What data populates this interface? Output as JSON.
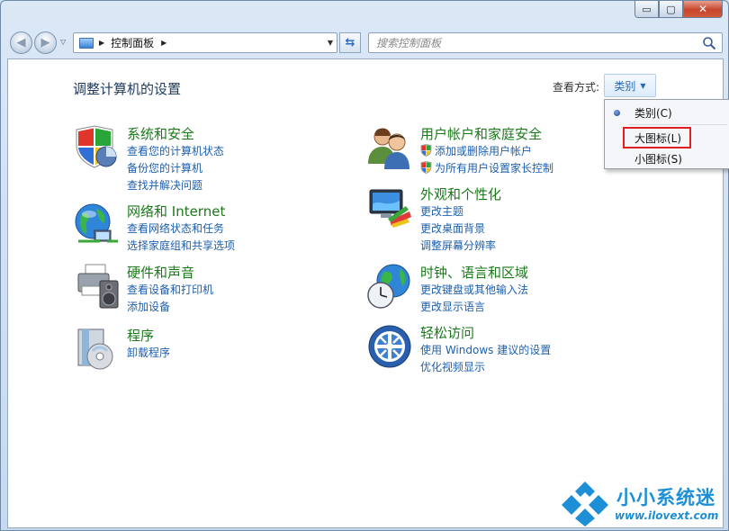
{
  "window": {
    "caption": {
      "minimize": "▭",
      "maximize": "▢",
      "close": "✕"
    }
  },
  "navbar": {
    "address": "控制面板",
    "search_placeholder": "搜索控制面板"
  },
  "page": {
    "title": "调整计算机的设置",
    "view_by_label": "查看方式:",
    "view_by_value": "类别"
  },
  "view_menu": {
    "items": [
      {
        "label": "类别(C)",
        "selected": true
      },
      {
        "label": "大图标(L)",
        "highlighted": true
      },
      {
        "label": "小图标(S)"
      }
    ]
  },
  "categories": [
    {
      "title": "系统和安全",
      "icon": "system-security-icon",
      "links": [
        "查看您的计算机状态",
        "备份您的计算机",
        "查找并解决问题"
      ]
    },
    {
      "title": "网络和 Internet",
      "icon": "network-internet-icon",
      "links": [
        "查看网络状态和任务",
        "选择家庭组和共享选项"
      ]
    },
    {
      "title": "硬件和声音",
      "icon": "hardware-sound-icon",
      "links": [
        "查看设备和打印机",
        "添加设备"
      ]
    },
    {
      "title": "程序",
      "icon": "programs-icon",
      "links": [
        "卸载程序"
      ]
    },
    {
      "title": "用户帐户和家庭安全",
      "icon": "user-accounts-icon",
      "links": [
        "添加或删除用户帐户",
        "为所有用户设置家长控制"
      ]
    },
    {
      "title": "外观和个性化",
      "icon": "appearance-icon",
      "links": [
        "更改主题",
        "更改桌面背景",
        "调整屏幕分辨率"
      ]
    },
    {
      "title": "时钟、语言和区域",
      "icon": "clock-language-icon",
      "links": [
        "更改键盘或其他输入法",
        "更改显示语言"
      ]
    },
    {
      "title": "轻松访问",
      "icon": "ease-of-access-icon",
      "links": [
        "使用 Windows 建议的设置",
        "优化视频显示"
      ]
    }
  ],
  "watermark": {
    "title": "小小系统迷",
    "url": "www.ilovext.com"
  }
}
